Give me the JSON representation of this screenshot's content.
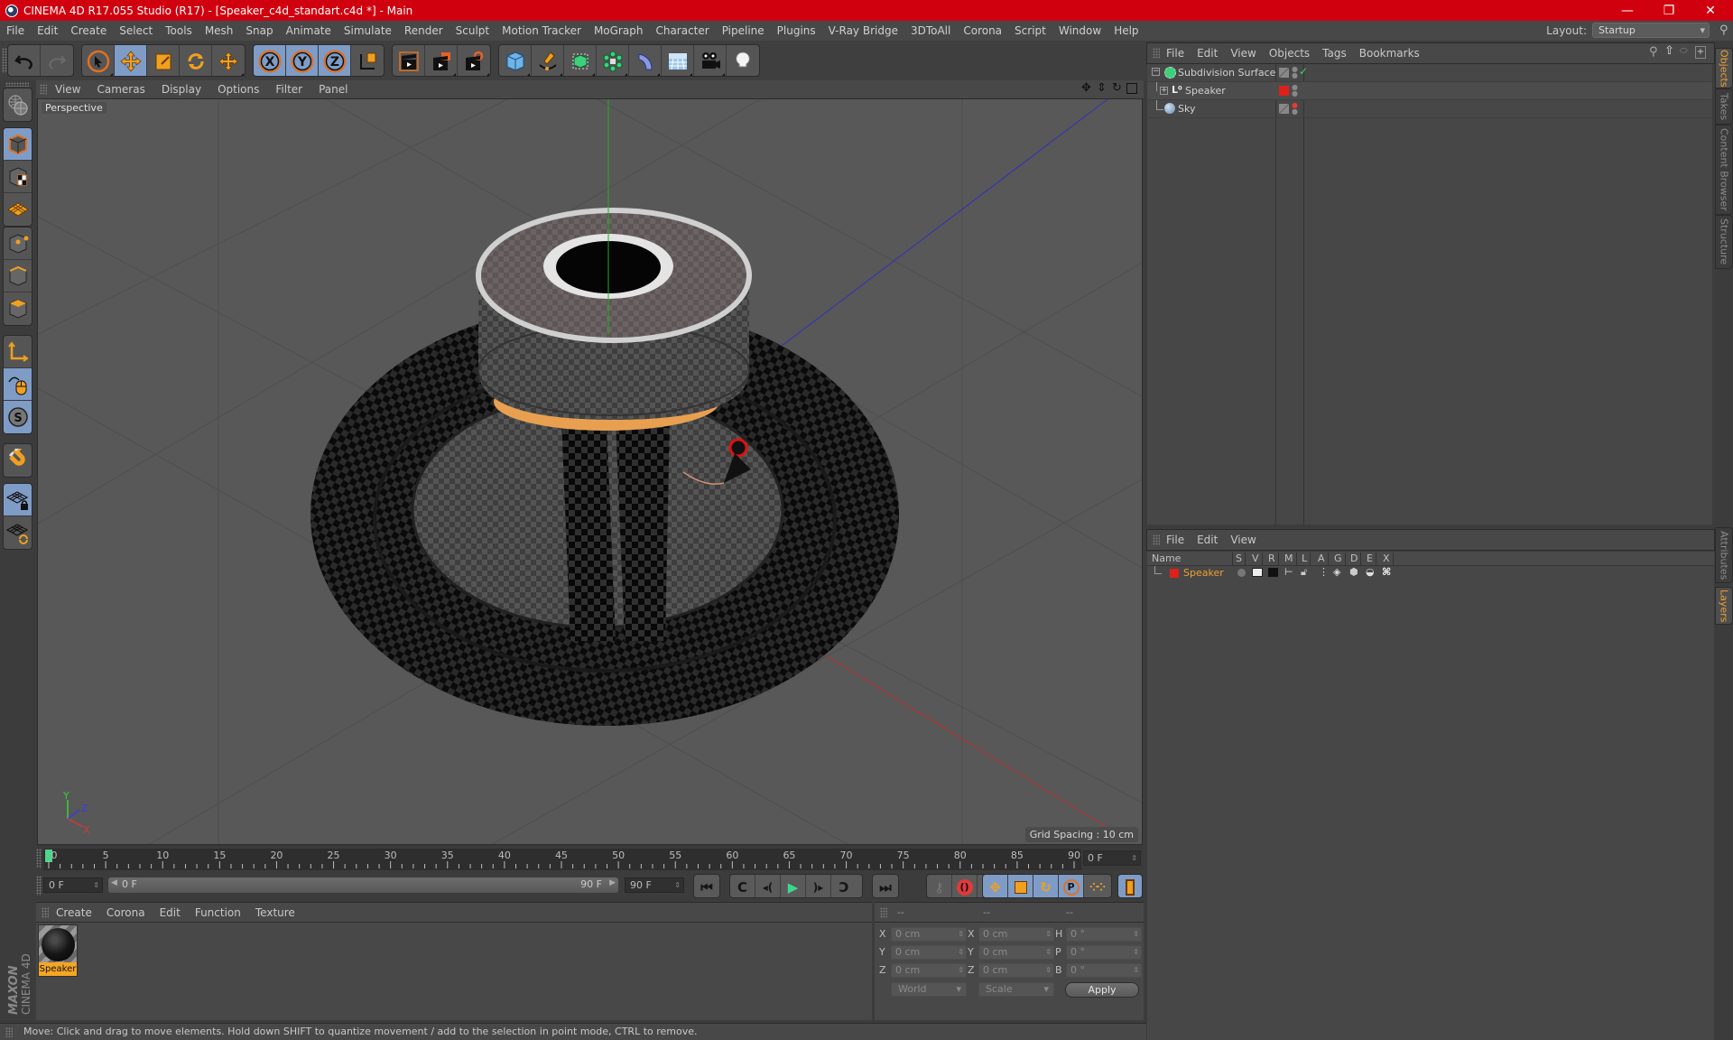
{
  "window": {
    "title": "CINEMA 4D R17.055 Studio (R17) - [Speaker_c4d_standart.c4d *] - Main",
    "minimize_icon": "minimize-icon",
    "maximize_icon": "restore-icon",
    "close_icon": "close-icon"
  },
  "menubar": {
    "items": [
      "File",
      "Edit",
      "Create",
      "Select",
      "Tools",
      "Mesh",
      "Snap",
      "Animate",
      "Simulate",
      "Render",
      "Sculpt",
      "Motion Tracker",
      "MoGraph",
      "Character",
      "Pipeline",
      "Plugins",
      "V-Ray Bridge",
      "3DToAll",
      "Corona",
      "Script",
      "Window",
      "Help"
    ],
    "layout_label": "Layout:",
    "layout_value": "Startup"
  },
  "toolbar": {
    "groups": [
      [
        "undo-icon",
        "redo-icon"
      ],
      [
        "live-selection-icon",
        "move-icon",
        "scale-icon",
        "rotate-icon",
        "transform-icon"
      ],
      [
        "x-axis-lock-icon",
        "y-axis-lock-icon",
        "z-axis-lock-icon",
        "coordinate-system-icon"
      ],
      [
        "render-view-icon",
        "render-to-picture-viewer-icon",
        "render-settings-icon"
      ],
      [
        "cube-icon",
        "pen-spline-icon",
        "subdivision-surface-icon",
        "cloner-icon",
        "deformer-icon",
        "floor-icon",
        "camera-icon",
        "light-icon"
      ]
    ],
    "axis_labels": [
      "X",
      "Y",
      "Z"
    ]
  },
  "left_palette": {
    "items": [
      "make-editable-icon",
      "model-mode-icon",
      "texture-mode-icon",
      "workplane-mode-icon",
      "points-mode-icon",
      "edges-mode-icon",
      "polygons-mode-icon",
      "axis-mode-icon",
      "tweak-mode-icon",
      "solo-mode-icon",
      "snapping-icon",
      "locked-workplane-icon",
      "workplane-alignment-icon"
    ]
  },
  "viewport": {
    "menu": [
      "View",
      "Cameras",
      "Display",
      "Options",
      "Filter",
      "Panel"
    ],
    "label": "Perspective",
    "grid_spacing": "Grid Spacing : 10 cm",
    "nav_icons": [
      "pan-icon",
      "dolly-icon",
      "orbit-icon",
      "toggle-view-icon"
    ],
    "axis_gizmo": {
      "x": "X",
      "y": "Y",
      "z": "Z"
    },
    "colors": {
      "x_axis": "#c83232",
      "y_axis": "#32c832",
      "z_axis": "#3232c8"
    }
  },
  "timeline": {
    "ticks": [
      "0",
      "5",
      "10",
      "15",
      "20",
      "25",
      "30",
      "35",
      "40",
      "45",
      "50",
      "55",
      "60",
      "65",
      "70",
      "75",
      "80",
      "85",
      "90"
    ],
    "current_frame": "0 F",
    "start_field": "0 F",
    "range_start": "0 F",
    "range_end": "90 F",
    "end_field": "90 F",
    "playhead_color": "#4fd68a"
  },
  "transport": {
    "buttons": [
      "go-to-start-icon",
      "previous-key-icon",
      "previous-frame-icon",
      "play-icon",
      "next-frame-icon",
      "next-key-icon",
      "go-to-end-icon"
    ],
    "key_buttons": [
      "record-keys-icon",
      "autokeying-icon",
      "keyframe-selection-icon"
    ],
    "track_buttons": [
      "position-track-icon",
      "scale-track-icon",
      "rotation-track-icon",
      "parameter-track-icon",
      "point-level-animation-icon"
    ],
    "timeline_button": "open-timeline-icon"
  },
  "material_manager": {
    "menu": [
      "Create",
      "Corona",
      "Edit",
      "Function",
      "Texture"
    ],
    "materials": [
      {
        "name": "Speaker"
      }
    ]
  },
  "coordinates": {
    "headers": [
      "--",
      "--",
      "--"
    ],
    "position": [
      {
        "axis": "X",
        "value": "0 cm"
      },
      {
        "axis": "Y",
        "value": "0 cm"
      },
      {
        "axis": "Z",
        "value": "0 cm"
      }
    ],
    "size": [
      {
        "axis": "X",
        "value": "0 cm"
      },
      {
        "axis": "Y",
        "value": "0 cm"
      },
      {
        "axis": "Z",
        "value": "0 cm"
      }
    ],
    "rotation": [
      {
        "axis": "H",
        "value": "0 °"
      },
      {
        "axis": "P",
        "value": "0 °"
      },
      {
        "axis": "B",
        "value": "0 °"
      }
    ],
    "mode_select": "World",
    "type_select": "Scale",
    "apply_label": "Apply"
  },
  "status_bar": {
    "text": "Move: Click and drag to move elements. Hold down SHIFT to quantize movement / add to the selection in point mode, CTRL to remove."
  },
  "object_manager": {
    "menu": [
      "File",
      "Edit",
      "View",
      "Objects",
      "Tags",
      "Bookmarks"
    ],
    "objects": [
      {
        "name": "Subdivision Surface",
        "icon": "subdivision-surface-icon",
        "expanded": true
      },
      {
        "name": "Speaker",
        "icon": "null-object-icon",
        "expanded": false
      },
      {
        "name": "Sky",
        "icon": "sky-icon"
      }
    ],
    "layer_color": "#e0201a"
  },
  "layer_manager": {
    "menu": [
      "File",
      "Edit",
      "View"
    ],
    "columns": [
      "Name",
      "S",
      "V",
      "R",
      "M",
      "L",
      "A",
      "G",
      "D",
      "E",
      "X"
    ],
    "layers": [
      {
        "name": "Speaker",
        "color": "#e0201a"
      }
    ]
  },
  "side_tabs": {
    "top": [
      {
        "label": "Objects",
        "active": true
      },
      {
        "label": "Takes",
        "active": false
      },
      {
        "label": "Content Browser",
        "active": false
      },
      {
        "label": "Structure",
        "active": false
      }
    ],
    "bottom": [
      {
        "label": "Attributes",
        "active": false
      },
      {
        "label": "Layers",
        "active": true
      }
    ]
  },
  "branding": {
    "line1": "MAXON",
    "line2": "CINEMA 4D"
  }
}
